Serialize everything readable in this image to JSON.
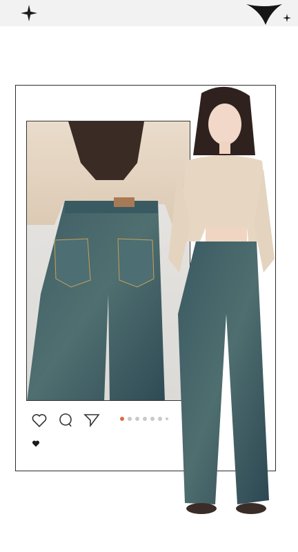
{
  "post": {
    "carousel": {
      "total": 7,
      "active_index": 0
    }
  },
  "colors": {
    "top_band": "#f2f2f2",
    "frame": "#2a2a2a",
    "active_dot": "#e06a3c",
    "inactive_dot": "#c9c9c9",
    "denim": "#3b5a63",
    "knit": "#e8d9c6"
  },
  "icons": [
    "sparkle-icon",
    "heart-outline-icon",
    "comment-icon",
    "send-icon",
    "heart-filled-icon"
  ]
}
